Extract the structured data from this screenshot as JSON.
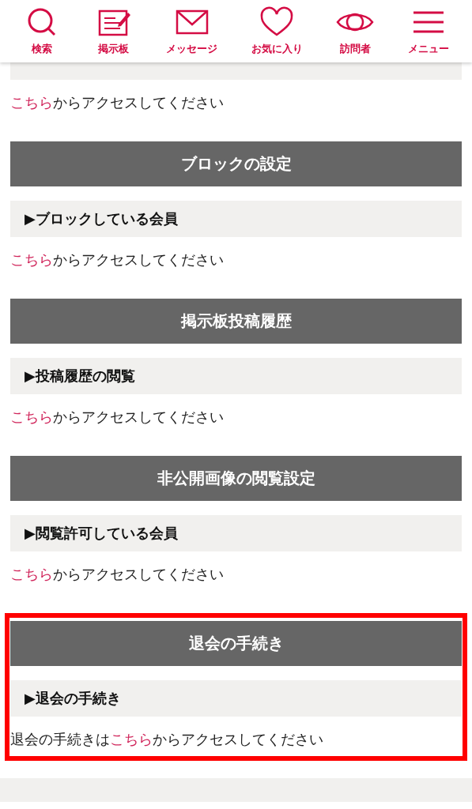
{
  "nav": [
    {
      "label": "検索"
    },
    {
      "label": "掲示板"
    },
    {
      "label": "メッセージ"
    },
    {
      "label": "お気に入り"
    },
    {
      "label": "訪問者"
    },
    {
      "label": "メニュー"
    }
  ],
  "sections": [
    {
      "text": {
        "link": "こちら",
        "after": "からアクセスしてください"
      },
      "highlighted": false
    },
    {
      "heading": "ブロックの設定",
      "subheading": "▶ブロックしている会員",
      "text": {
        "link": "こちら",
        "after": "からアクセスしてください"
      },
      "highlighted": false
    },
    {
      "heading": "掲示板投稿履歴",
      "subheading": "▶投稿履歴の閲覧",
      "text": {
        "link": "こちら",
        "after": "からアクセスしてください"
      },
      "highlighted": false
    },
    {
      "heading": "非公開画像の閲覧設定",
      "subheading": "▶閲覧許可している会員",
      "text": {
        "link": "こちら",
        "after": "からアクセスしてください"
      },
      "highlighted": false
    },
    {
      "heading": "退会の手続き",
      "subheading": "▶退会の手続き",
      "text": {
        "before": "退会の手続きは",
        "link": "こちら",
        "after": "からアクセスしてください"
      },
      "highlighted": true
    }
  ]
}
